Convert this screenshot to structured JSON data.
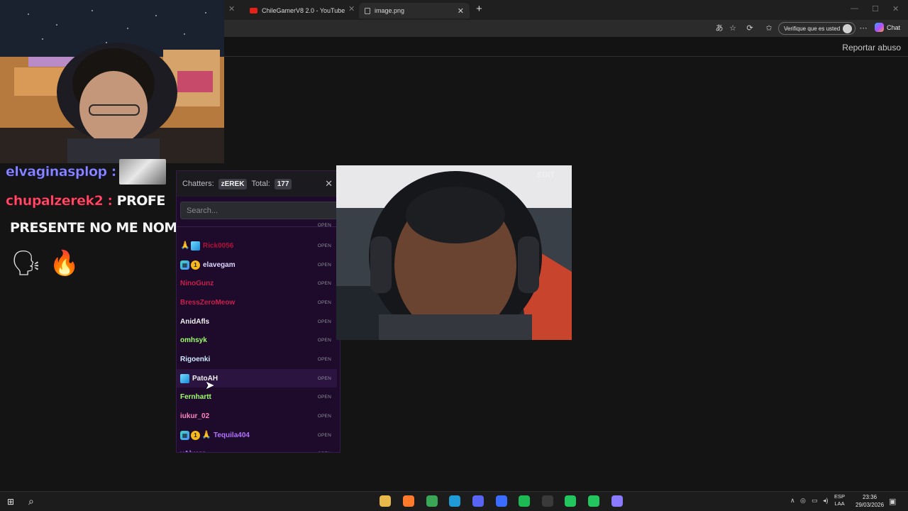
{
  "browser": {
    "tabs": [
      {
        "title": "ChileGamerV8 2.0 - YouTube",
        "icon": "youtube-icon"
      },
      {
        "title": "image.png",
        "icon": "image-icon"
      }
    ],
    "profile_label": "Verifique que es usted",
    "copilot_label": "Chat"
  },
  "page": {
    "report_link": "Reportar abuso"
  },
  "stream_chat": {
    "line1_name": "elvaginasplop :",
    "line2_name": "chupalzerek2 :",
    "line2_msg": " PROFE",
    "line3": "PRESENTE NO ME NOMBRÓ",
    "emotes": [
      "🗣",
      "🔥"
    ]
  },
  "chatters_panel": {
    "label": "Chatters:",
    "channel": "zEREK",
    "total_label": "Total:",
    "total": "177",
    "search_placeholder": "Search...",
    "open_label": "OPEN",
    "chatters": [
      {
        "name": "",
        "badges": [],
        "color": "#c04a6a"
      },
      {
        "name": "Rick0056",
        "badges": [
          "fire",
          "cube"
        ],
        "color": "#b0103a"
      },
      {
        "name": "elavegam",
        "badges": [
          "gift",
          "coin"
        ],
        "color": "#ded8ff"
      },
      {
        "name": "NinoGunz",
        "badges": [],
        "color": "#c8204a"
      },
      {
        "name": "BressZeroMeow",
        "badges": [],
        "color": "#c8204a"
      },
      {
        "name": "AnidAfls",
        "badges": [],
        "color": "#f0f0f0"
      },
      {
        "name": "omhsyk",
        "badges": [],
        "color": "#9dff6a"
      },
      {
        "name": "Rigoenki",
        "badges": [],
        "color": "#cfeaff"
      },
      {
        "name": "PatoAH",
        "badges": [
          "cube"
        ],
        "color": "#f0f0f0"
      },
      {
        "name": "Fernhartt",
        "badges": [],
        "color": "#9dff6a"
      },
      {
        "name": "iukur_02",
        "badges": [],
        "color": "#ff86c0"
      },
      {
        "name": "Tequila404",
        "badges": [
          "gift",
          "coin",
          "fire"
        ],
        "color": "#b072ff"
      },
      {
        "name": "vAlvaro",
        "badges": [],
        "color": "#b072ff"
      }
    ]
  },
  "video": {
    "badge": "EDIT"
  },
  "taskbar": {
    "lang_line1": "ESP",
    "lang_line2": "LAA",
    "time": "23:36",
    "date": "29/03/2026",
    "apps": [
      {
        "name": "file-explorer-icon",
        "color": "#e8b84a"
      },
      {
        "name": "firefox-icon",
        "color": "#ff7a2a"
      },
      {
        "name": "chrome-icon",
        "color": "#3aa757"
      },
      {
        "name": "edge-icon",
        "color": "#1f9bd7"
      },
      {
        "name": "discord-icon",
        "color": "#5865f2"
      },
      {
        "name": "vpn-icon",
        "color": "#3a6cff"
      },
      {
        "name": "spotify-icon",
        "color": "#1db954"
      },
      {
        "name": "obs-icon",
        "color": "#3a3a3a"
      },
      {
        "name": "kick-icon",
        "color": "#22c55e"
      },
      {
        "name": "play-icon",
        "color": "#22c55e"
      },
      {
        "name": "browser-icon",
        "color": "#8a7aff"
      }
    ]
  }
}
